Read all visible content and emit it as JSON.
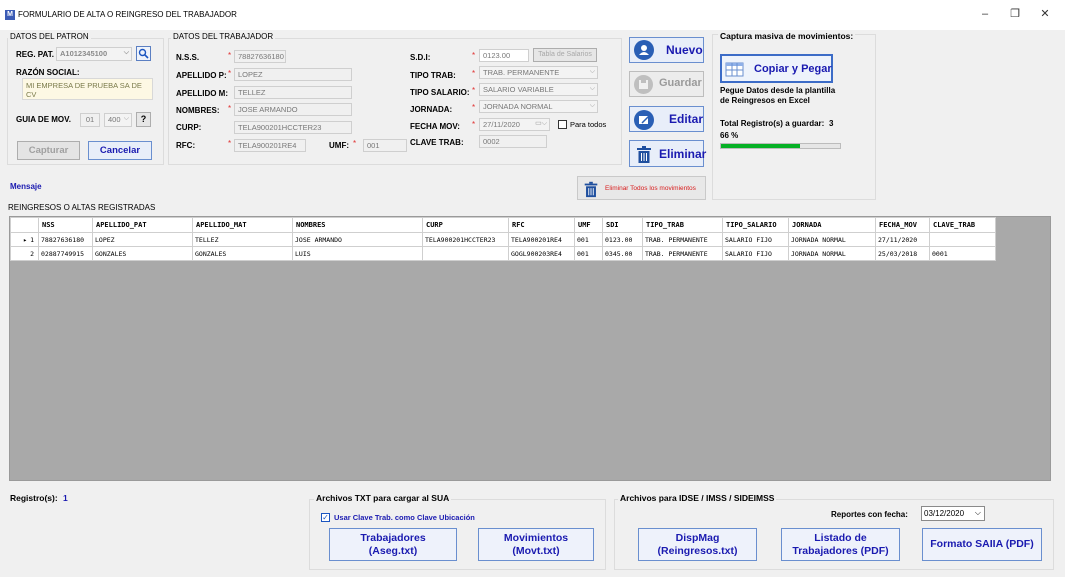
{
  "window": {
    "title": "FORMULARIO DE ALTA O REINGRESO DEL TRABAJADOR",
    "icon_letter": "M",
    "minimize": "–",
    "restore": "❐",
    "close": "✕"
  },
  "patron": {
    "group_label": "DATOS DEL PATRON",
    "reg_pat_label": "REG. PAT.",
    "reg_pat_value": "A1012345100",
    "razon_label": "RAZÓN SOCIAL:",
    "razon_value": "MI EMPRESA DE PRUEBA SA DE CV",
    "guia_label": "GUIA DE MOV.",
    "guia_a": "01",
    "guia_b": "400",
    "help": "?",
    "capturar": "Capturar",
    "cancelar": "Cancelar"
  },
  "trabajador": {
    "group_label": "DATOS DEL TRABAJADOR",
    "nss_label": "N.S.S.",
    "nss_value": "78827636180",
    "ap_label": "APELLIDO P:",
    "ap_value": "LOPEZ",
    "am_label": "APELLIDO M:",
    "am_value": "TELLEZ",
    "nombres_label": "NOMBRES:",
    "nombres_value": "JOSE ARMANDO",
    "curp_label": "CURP:",
    "curp_value": "TELA900201HCCTER23",
    "rfc_label": "RFC:",
    "rfc_value": "TELA900201RE4",
    "umf_label": "UMF:",
    "umf_value": "001",
    "sdi_label": "S.D.I:",
    "sdi_value": "0123.00",
    "tabla_salarios": "Tabla de Salarios",
    "tipo_trab_label": "TIPO TRAB:",
    "tipo_trab_value": "TRAB. PERMANENTE",
    "tipo_sal_label": "TIPO SALARIO:",
    "tipo_sal_value": "SALARIO VARIABLE",
    "jornada_label": "JORNADA:",
    "jornada_value": "JORNADA NORMAL",
    "fecha_label": "FECHA MOV:",
    "fecha_value": "27/11/2020",
    "para_todos": "Para todos",
    "clave_label": "CLAVE TRAB:",
    "clave_value": "0002",
    "req": "*"
  },
  "actions": {
    "nuevo": "Nuevo",
    "guardar": "Guardar",
    "editar": "Editar",
    "eliminar": "Eliminar",
    "eliminar_todos": "Eliminar Todos los movimientos"
  },
  "masiva": {
    "title": "Captura masiva de movimientos:",
    "copiar": "Copiar y Pegar",
    "desc": "Pegue Datos desde la plantilla de Reingresos en Excel",
    "total_label": "Total Registro(s) a guardar:",
    "total_value": "3",
    "progress_text": "66 %",
    "progress": 0.66
  },
  "mensaje": "Mensaje",
  "grid": {
    "label": "REINGRESOS O ALTAS REGISTRADAS",
    "columns": [
      "NSS",
      "APELLIDO_PAT",
      "APELLIDO_MAT",
      "NOMBRES",
      "CURP",
      "RFC",
      "UMF",
      "SDI",
      "TIPO_TRAB",
      "TIPO_SALARIO",
      "JORNADA",
      "FECHA_MOV",
      "CLAVE_TRAB"
    ],
    "rows": [
      {
        "num": "1",
        "marker": "▸",
        "cells": [
          "78827636180",
          "LOPEZ",
          "TELLEZ",
          "JOSE ARMANDO",
          "TELA900201HCCTER23",
          "TELA900201RE4",
          "001",
          "0123.00",
          "TRAB. PERMANENTE",
          "SALARIO FIJO",
          "JORNADA NORMAL",
          "27/11/2020",
          ""
        ]
      },
      {
        "num": "2",
        "marker": "",
        "cells": [
          "02887749915",
          "GONZALES",
          "GONZALES",
          "LUIS",
          "",
          "GOGL900203RE4",
          "001",
          "0345.00",
          "TRAB. PERMANENTE",
          "SALARIO FIJO",
          "JORNADA NORMAL",
          "25/03/2018",
          "0001"
        ]
      }
    ]
  },
  "footer": {
    "registros_label": "Registro(s):",
    "registros_value": "1",
    "sua_title": "Archivos  TXT para cargar al SUA",
    "usar_clave": "Usar Clave Trab. como Clave Ubicación",
    "trabajadores_1": "Trabajadores",
    "trabajadores_2": "(Aseg.txt)",
    "movimientos_1": "Movimientos",
    "movimientos_2": "(Movt.txt)",
    "idse_title": "Archivos para IDSE / IMSS / SIDEIMSS",
    "reportes_label": "Reportes con fecha:",
    "reportes_fecha": "03/12/2020",
    "dispmag_1": "DispMag",
    "dispmag_2": "(Reingresos.txt)",
    "listado_1": "Listado de",
    "listado_2": "Trabajadores (PDF)",
    "saiia": "Formato SAIIA (PDF)"
  }
}
